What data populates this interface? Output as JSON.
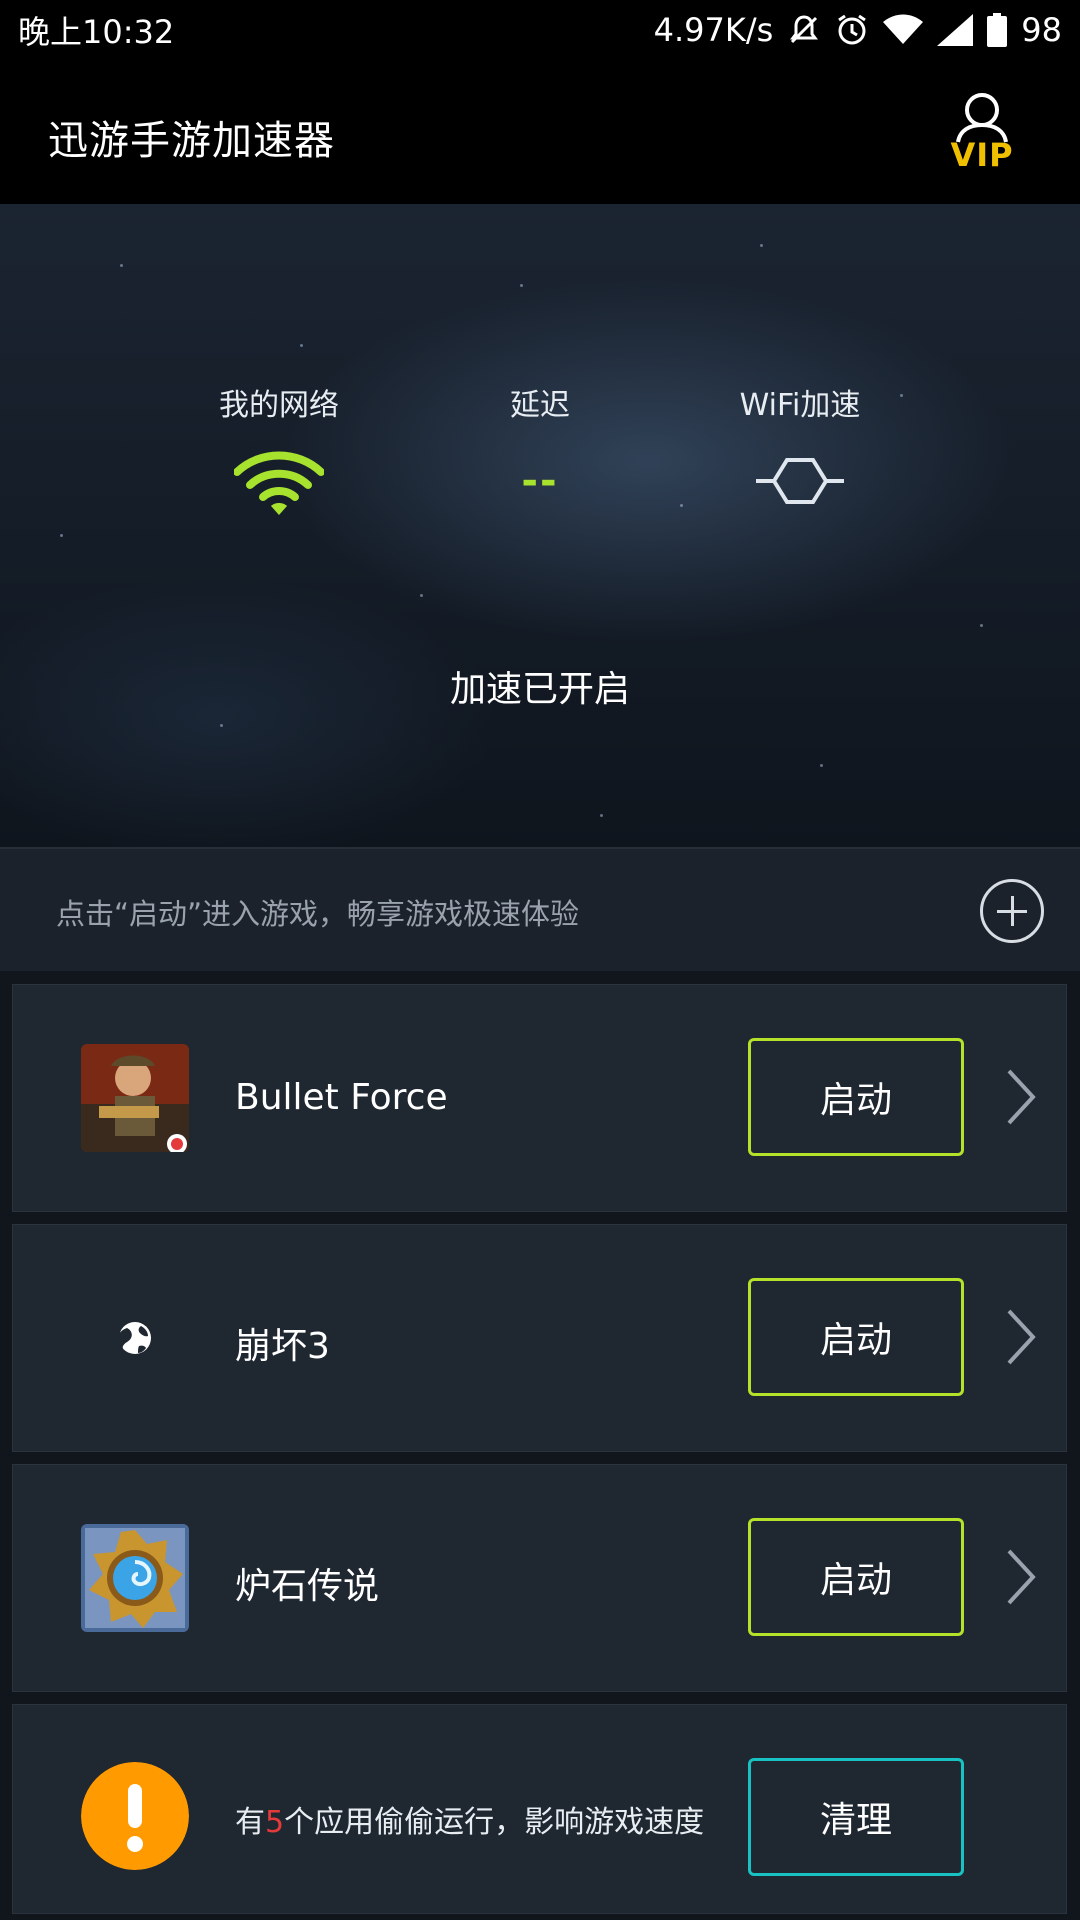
{
  "status_bar": {
    "time": "晚上10:32",
    "network_speed": "4.97K/s",
    "battery": "98",
    "icons": [
      "mute-icon",
      "alarm-icon",
      "wifi-icon",
      "signal-icon",
      "battery-icon"
    ]
  },
  "app_bar": {
    "title": "迅游手游加速器",
    "vip_label": "VIP"
  },
  "hero": {
    "metrics": [
      {
        "label": "我的网络",
        "icon": "wifi-icon"
      },
      {
        "label": "延迟",
        "value": "--"
      },
      {
        "label": "WiFi加速",
        "icon": "hexagon-link-icon"
      }
    ],
    "status": "加速已开启"
  },
  "hint": {
    "text": "点击“启动”进入游戏，畅享游戏极速体验"
  },
  "games": [
    {
      "name": "Bullet Force",
      "button": "启动",
      "icon": "bullet-force-icon"
    },
    {
      "name": "崩坏3",
      "button": "启动",
      "icon": "globe-icon"
    },
    {
      "name": "炉石传说",
      "button": "启动",
      "icon": "hearthstone-icon"
    }
  ],
  "warning": {
    "prefix": "有",
    "count": "5",
    "suffix": "个应用偷偷运行，影响游戏速度",
    "button": "清理"
  },
  "colors": {
    "accent_green": "#b4e12a",
    "accent_cyan": "#19c2c2",
    "vip_gold": "#f0c000",
    "warning_orange": "#ff9a00",
    "count_red": "#e53a3a"
  }
}
